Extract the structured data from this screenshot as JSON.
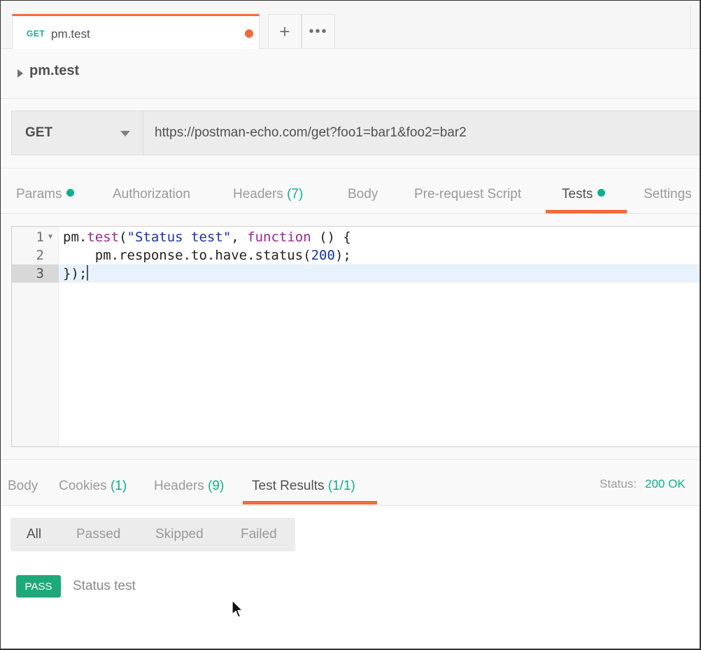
{
  "tabbar": {
    "tab": {
      "method": "GET",
      "name": "pm.test"
    },
    "plus_icon": "+",
    "more_icon": "•••"
  },
  "request": {
    "title": "pm.test",
    "method": "GET",
    "url": "https://postman-echo.com/get?foo1=bar1&foo2=bar2"
  },
  "request_tabs": {
    "params": "Params",
    "authorization": "Authorization",
    "headers": "Headers",
    "headers_count": "(7)",
    "body": "Body",
    "prerequest": "Pre-request Script",
    "tests": "Tests",
    "settings": "Settings"
  },
  "editor": {
    "line_numbers": [
      "1",
      "2",
      "3"
    ]
  },
  "response_tabs": {
    "body": "Body",
    "cookies": "Cookies",
    "cookies_count": "(1)",
    "headers": "Headers",
    "headers_count": "(9)",
    "test_results": "Test Results",
    "test_results_count": "(1/1)",
    "status_label": "Status:",
    "status_value": "200 OK"
  },
  "filter": {
    "all": "All",
    "passed": "Passed",
    "skipped": "Skipped",
    "failed": "Failed"
  },
  "results": [
    {
      "badge": "PASS",
      "name": "Status test"
    }
  ],
  "colors": {
    "accent_orange": "#f26b3a",
    "success_green": "#0cb08c",
    "pass_badge": "#1fa87a"
  }
}
